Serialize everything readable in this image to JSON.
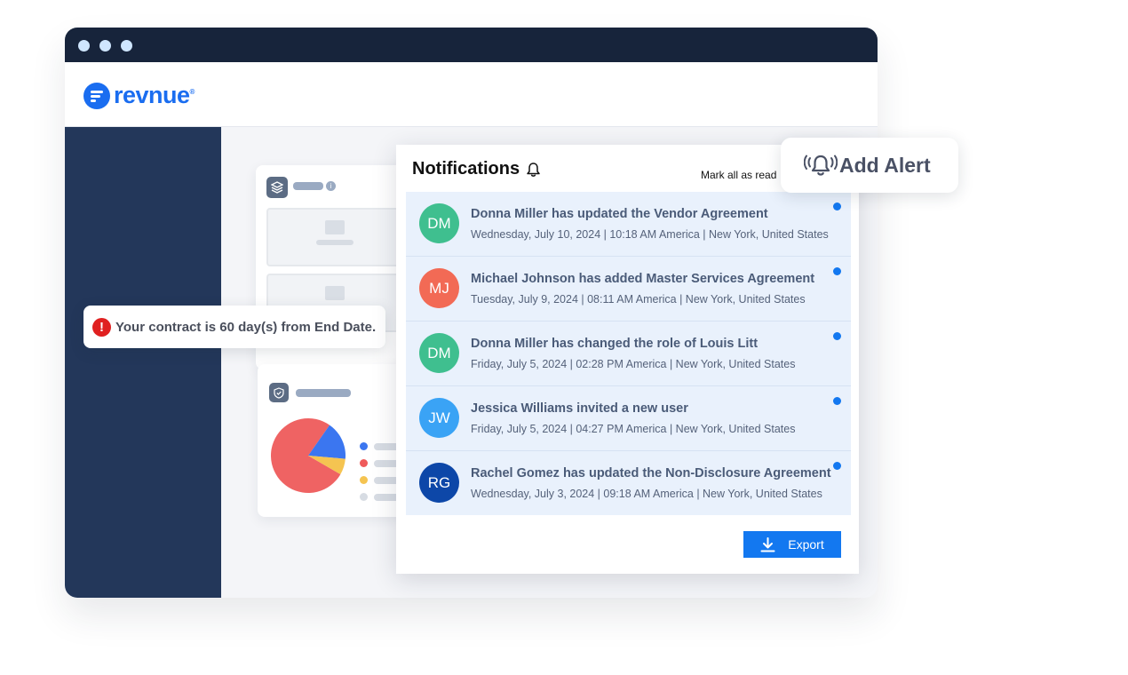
{
  "brand": {
    "name": "revnue",
    "color": "#1a6df0"
  },
  "contract_alert": {
    "icon": "exclamation-icon",
    "text": "Your contract is 60 day(s) from End Date."
  },
  "notifications": {
    "title": "Notifications",
    "mark_all_label": "Mark all as read",
    "items": [
      {
        "initials": "DM",
        "avatar_color": "#3fbf8f",
        "title": "Donna Miller has updated the Vendor Agreement",
        "timestamp": "Wednesday, July 10, 2024 | 10:18 AM America | New York, United States"
      },
      {
        "initials": "MJ",
        "avatar_color": "#f26a55",
        "title": "Michael Johnson has added Master Services Agreement",
        "timestamp": "Tuesday, July 9, 2024 | 08:11 AM America | New York, United States"
      },
      {
        "initials": "DM",
        "avatar_color": "#3fbf8f",
        "title": "Donna Miller has changed the role of Louis Litt",
        "timestamp": "Friday, July 5, 2024 | 02:28 PM America | New York, United States"
      },
      {
        "initials": "JW",
        "avatar_color": "#3aa3f5",
        "title": "Jessica Williams invited a new user",
        "timestamp": "Friday, July 5, 2024 | 04:27 PM America | New York, United States"
      },
      {
        "initials": "RG",
        "avatar_color": "#0d47a8",
        "title": "Rachel Gomez has updated the Non-Disclosure Agreement",
        "timestamp": "Wednesday, July 3, 2024 | 09:18 AM America | New York, United States"
      }
    ],
    "export_label": "Export"
  },
  "add_alert": {
    "label": "Add Alert"
  },
  "pie_colors": [
    "#ef6363",
    "#3b76f0",
    "#f5c451"
  ]
}
